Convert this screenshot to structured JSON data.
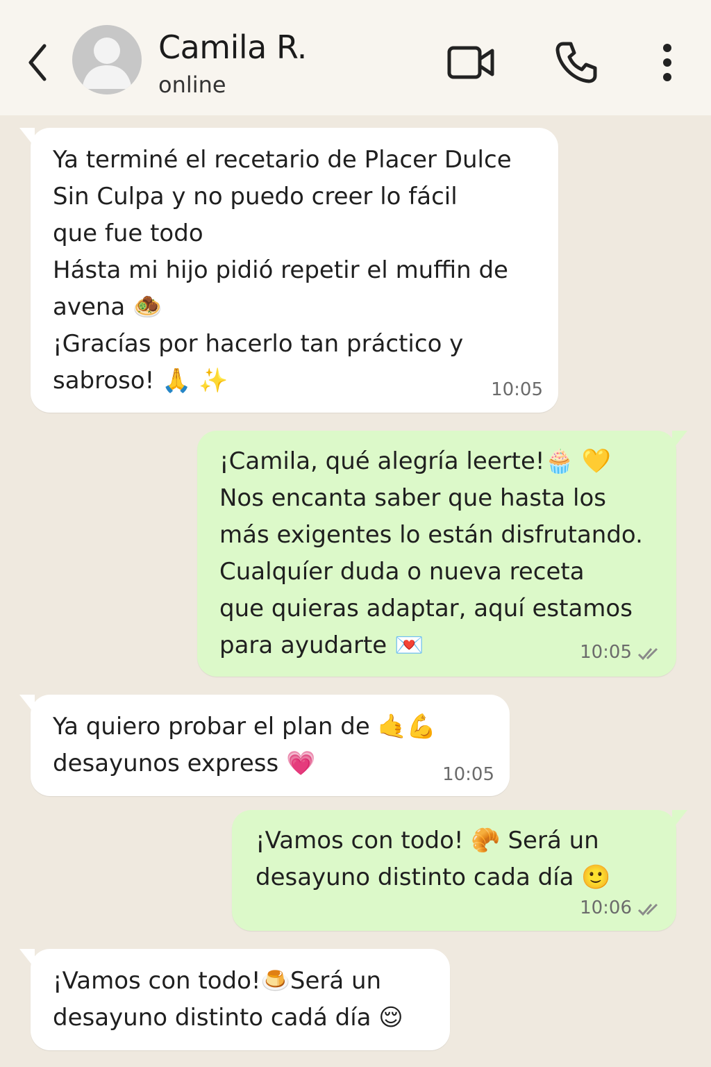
{
  "header": {
    "contact_name": "Camila R.",
    "status": "online",
    "back_icon": "chevron-left-icon",
    "video_icon": "video-camera-icon",
    "call_icon": "phone-icon",
    "menu_icon": "more-vertical-icon"
  },
  "colors": {
    "header_bg": "#f8f5ef",
    "chat_bg": "#efe9df",
    "incoming_bubble": "#ffffff",
    "outgoing_bubble": "#dcf9c9",
    "read_ticks": "#8a8a8a"
  },
  "messages": [
    {
      "direction": "incoming",
      "text": "Ya terminé el recetario de Placer Dulce\nSin Culpa y no puedo creer lo fácil\nque fue todo\nHásta mi hijo pidió repetir el muffin de\navena 🧆\n¡Gracías por hacerlo tan práctico y\nsabroso! 🙏 ✨",
      "time": "10:05"
    },
    {
      "direction": "outgoing",
      "text": "¡Camila, qué alegría leerte!🧁 💛\nNos encanta saber que hasta los\nmás exigentes lo están disfrutando.\nCualquíer duda o nueva receta\nque quieras adaptar, aquí estamos\npara ayudarte 💌",
      "time": "10:05",
      "ticks": "✓✓"
    },
    {
      "direction": "incoming",
      "text": "Ya quiero probar el plan de 🤙💪\ndesayunos express 💗",
      "time": "10:05"
    },
    {
      "direction": "outgoing",
      "text": "¡Vamos con todo! 🥐 Será un\ndesayuno distinto cada día 🙂",
      "time": "10:06",
      "ticks": "✓✓"
    },
    {
      "direction": "incoming",
      "text": "¡Vamos con todo!🍮Será un\ndesayuno distinto cadá día 😌",
      "time": ""
    }
  ]
}
